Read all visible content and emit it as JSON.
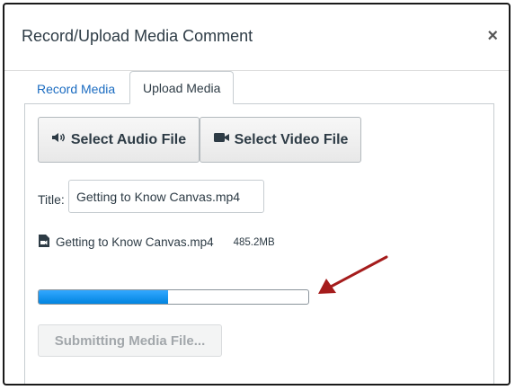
{
  "dialog": {
    "title": "Record/Upload Media Comment",
    "close_symbol": "×"
  },
  "tabs": [
    {
      "label": "Record Media",
      "active": false
    },
    {
      "label": "Upload Media",
      "active": true
    }
  ],
  "upload": {
    "audio_button_label": "Select Audio File",
    "audio_icon": "speaker-icon",
    "video_button_label": "Select Video File",
    "video_icon": "video-camera-icon",
    "title_label": "Title:",
    "title_value": "Getting to Know Canvas.mp4",
    "file_name": "Getting to Know Canvas.mp4",
    "file_size": "485.2MB",
    "file_icon": "video-file-icon",
    "progress_fraction": 0.48,
    "submit_label": "Submitting Media File..."
  },
  "annotation": {
    "arrow_color": "#a51c1c"
  },
  "colors": {
    "link": "#1b6cc1",
    "progress": "#0b8fef"
  }
}
